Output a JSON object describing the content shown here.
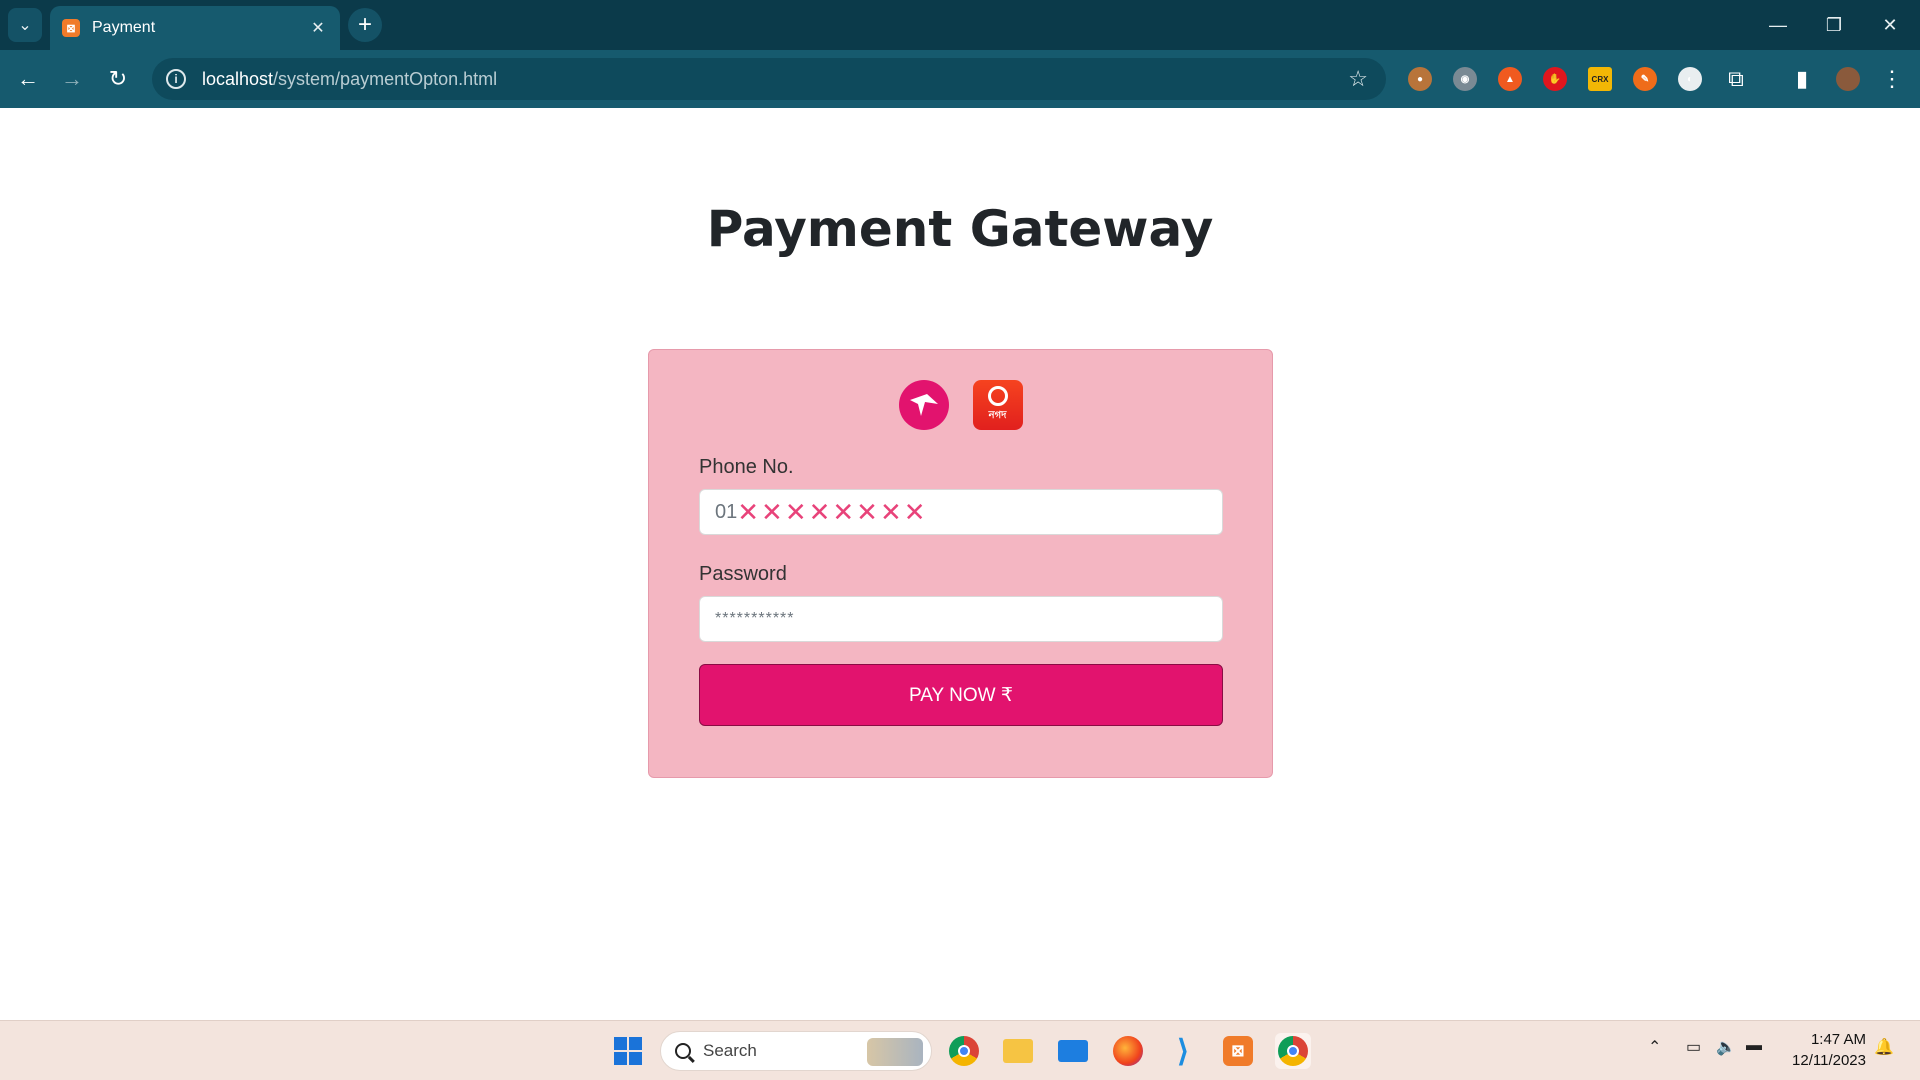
{
  "browser": {
    "tab_title": "Payment",
    "tab_favicon_icon": "xampp-icon",
    "url_host": "localhost",
    "url_path": "/system/paymentOpton.html",
    "extensions": [
      {
        "name": "cookie-extension-icon",
        "color": "#b8743a",
        "glyph": "●"
      },
      {
        "name": "raccoon-extension-icon",
        "color": "#7a8a94",
        "glyph": "◉"
      },
      {
        "name": "fire-extension-icon",
        "color": "#f05a1f",
        "glyph": "▲"
      },
      {
        "name": "stop-hand-extension-icon",
        "color": "#e0161e",
        "glyph": "✋"
      },
      {
        "name": "crx-extension-icon",
        "color": "#f2b705",
        "glyph": "CRX"
      },
      {
        "name": "colorpick-extension-icon",
        "color": "#ef6c1a",
        "glyph": "✎"
      },
      {
        "name": "circle-extension-icon",
        "color": "#e9eef0",
        "glyph": "◐"
      }
    ]
  },
  "page": {
    "heading": "Payment Gateway",
    "logos": [
      "bkash-logo",
      "nagad-logo"
    ],
    "nagad_label": "নগদ",
    "phone_label": "Phone No.",
    "phone_prefix": "01",
    "phone_masked": "✕✕✕✕✕✕✕✕",
    "password_label": "Password",
    "password_value": "***********",
    "pay_button": "PAY NOW ₹",
    "accent_color": "#e2136e",
    "card_color": "#f4b6c2"
  },
  "taskbar": {
    "search_placeholder": "Search",
    "time": "1:47 AM",
    "date": "12/11/2023"
  }
}
